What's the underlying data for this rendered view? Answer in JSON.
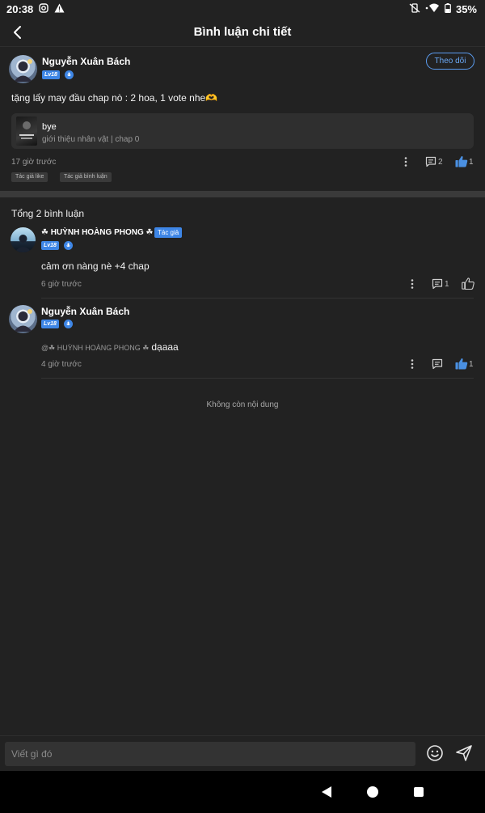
{
  "status_bar": {
    "time": "20:38",
    "battery": "35%",
    "icons_left": [
      "instagram-icon",
      "warning-icon"
    ],
    "icons_right": [
      "vibrate-off-icon",
      "wifi-icon",
      "battery-icon"
    ]
  },
  "header": {
    "title": "Bình luận chi tiết",
    "back_icon": "chevron-left-icon"
  },
  "main_comment": {
    "author": "Nguyễn Xuân Bách",
    "level": "Lv18",
    "follow_label": "Theo dõi",
    "text": "tặng lấy may đầu chap nò : 2 hoa, 1 vote nhe🫶",
    "chapter": {
      "title": "bye",
      "subtitle": "giới thiệu nhân vật | chap 0"
    },
    "time": "17 giờ trước",
    "reply_count": "2",
    "like_count": "1",
    "tags": [
      "Tác giả like",
      "Tác giả bình luận"
    ]
  },
  "replies_section": {
    "total_label": "Tổng 2 bình luận",
    "no_more_label": "Không còn nội dung",
    "replies": [
      {
        "author": "☘ HUỲNH HOÀNG PHONG ☘",
        "author_badge": "Tác giả",
        "level": "Lv18",
        "text": "cảm ơn nàng nè +4 chap",
        "time": "6 giờ trước",
        "reply_count": "1"
      },
      {
        "author": "Nguyễn Xuân Bách",
        "level": "Lv18",
        "mention": "@☘ HUỲNH HOÀNG PHONG ☘",
        "text": "dạaaa",
        "time": "4 giờ trước",
        "like_count": "1"
      }
    ]
  },
  "input_bar": {
    "placeholder": "Viết gì đó",
    "emoji_icon": "smile-icon",
    "send_icon": "send-icon"
  },
  "colors": {
    "background": "#222222",
    "accent": "#3e86e6",
    "liked": "#4a90e2"
  }
}
